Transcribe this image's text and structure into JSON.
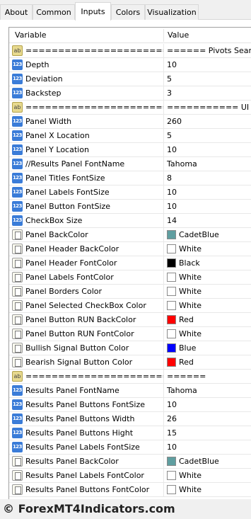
{
  "tabs": [
    {
      "label": "About",
      "active": false
    },
    {
      "label": "Common",
      "active": false
    },
    {
      "label": "Inputs",
      "active": true
    },
    {
      "label": "Colors",
      "active": false
    },
    {
      "label": "Visualization",
      "active": false
    }
  ],
  "grid": {
    "header_variable": "Variable",
    "header_value": "Value"
  },
  "rows": [
    {
      "type": "string",
      "label": "============================",
      "value": "====== Pivots Search"
    },
    {
      "type": "number",
      "label": "Depth",
      "value": "10"
    },
    {
      "type": "number",
      "label": "Deviation",
      "value": "5"
    },
    {
      "type": "number",
      "label": "Backstep",
      "value": "3"
    },
    {
      "type": "string",
      "label": "============================",
      "value": "=========== UI Se"
    },
    {
      "type": "number",
      "label": "Panel Width",
      "value": "260"
    },
    {
      "type": "number",
      "label": "Panel X Location",
      "value": "5"
    },
    {
      "type": "number",
      "label": "Panel Y Location",
      "value": "10"
    },
    {
      "type": "number",
      "label": "//Results Panel FontName",
      "value": "Tahoma"
    },
    {
      "type": "number",
      "label": "Panel Titles FontSize",
      "value": "8"
    },
    {
      "type": "number",
      "label": "Panel Labels FontSize",
      "value": "10"
    },
    {
      "type": "number",
      "label": "Panel Button FontSize",
      "value": "10"
    },
    {
      "type": "number",
      "label": "CheckBox Size",
      "value": "14"
    },
    {
      "type": "color",
      "label": "Panel BackColor",
      "value": "CadetBlue",
      "swatch": "#5f9ea0"
    },
    {
      "type": "color",
      "label": "Panel Header BackColor",
      "value": "White",
      "swatch": "#ffffff"
    },
    {
      "type": "color",
      "label": "Panel Header FontColor",
      "value": "Black",
      "swatch": "#000000"
    },
    {
      "type": "color",
      "label": "Panel Labels FontColor",
      "value": "White",
      "swatch": "#ffffff"
    },
    {
      "type": "color",
      "label": "Panel Borders Color",
      "value": "White",
      "swatch": "#ffffff"
    },
    {
      "type": "color",
      "label": "Panel Selected CheckBox Color",
      "value": "White",
      "swatch": "#ffffff"
    },
    {
      "type": "color",
      "label": "Panel Button RUN BackColor",
      "value": "Red",
      "swatch": "#ff0000"
    },
    {
      "type": "color",
      "label": "Panel Button RUN FontColor",
      "value": "White",
      "swatch": "#ffffff"
    },
    {
      "type": "color",
      "label": "Bullish Signal Button Color",
      "value": "Blue",
      "swatch": "#0000ff"
    },
    {
      "type": "color",
      "label": "Bearish Signal Button Color",
      "value": "Red",
      "swatch": "#ff0000"
    },
    {
      "type": "string",
      "label": "============================",
      "value": "======"
    },
    {
      "type": "number",
      "label": "Results Panel FontName",
      "value": "Tahoma"
    },
    {
      "type": "number",
      "label": "Results Panel Buttons FontSize",
      "value": "10"
    },
    {
      "type": "number",
      "label": "Results Panel Buttons Width",
      "value": "26"
    },
    {
      "type": "number",
      "label": "Results Panel Buttons Hight",
      "value": "15"
    },
    {
      "type": "number",
      "label": "Results Panel Labels FontSize",
      "value": "10"
    },
    {
      "type": "color",
      "label": "Results Panel BackColor",
      "value": "CadetBlue",
      "swatch": "#5f9ea0"
    },
    {
      "type": "color",
      "label": "Results Panel Labels FontColor",
      "value": "White",
      "swatch": "#ffffff"
    },
    {
      "type": "color",
      "label": "Results Panel Buttons FontColor",
      "value": "White",
      "swatch": "#ffffff"
    }
  ],
  "icons": {
    "number": "123",
    "string": "ab"
  },
  "footer": {
    "text": "© ForexMT4Indicators.com"
  }
}
